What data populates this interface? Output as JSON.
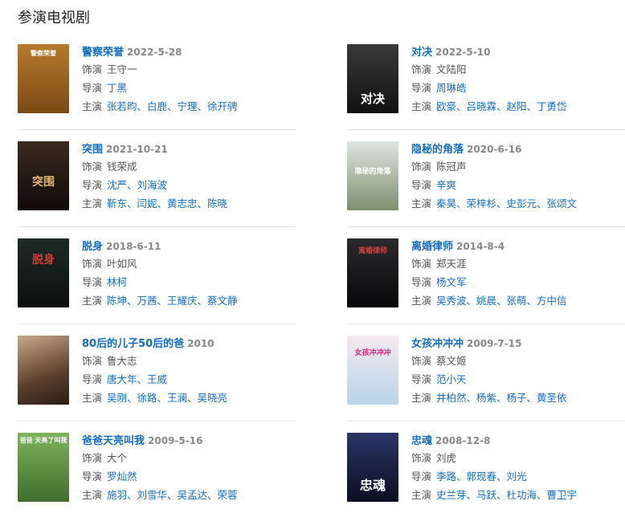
{
  "section_title": "参演电视剧",
  "labels": {
    "role": "饰演",
    "director": "导演",
    "cast": "主演"
  },
  "shows": [
    {
      "title": "警察荣誉",
      "date": "2022-5-28",
      "role": "王守一",
      "director": "丁黑",
      "cast": "张若昀、白鹿、宁理、徐开骋",
      "poster": "警察荣誉"
    },
    {
      "title": "对决",
      "date": "2022-5-10",
      "role": "文陆阳",
      "director": "周琳皓",
      "cast": "欧豪、吕晓霖、赵阳、丁勇岱",
      "poster": "对决"
    },
    {
      "title": "突围",
      "date": "2021-10-21",
      "role": "钱荣成",
      "director": "沈严、刘海波",
      "cast": "靳东、闫妮、黄志忠、陈晓",
      "poster": "突围"
    },
    {
      "title": "隐秘的角落",
      "date": "2020-6-16",
      "role": "陈冠声",
      "director": "辛爽",
      "cast": "秦昊、荣梓杉、史彭元、张颂文",
      "poster": "隐秘的角落"
    },
    {
      "title": "脱身",
      "date": "2018-6-11",
      "role": "叶如风",
      "director": "林柯",
      "cast": "陈坤、万茜、王耀庆、蔡文静",
      "poster": "脱身"
    },
    {
      "title": "离婚律师",
      "date": "2014-8-4",
      "role": "郑天涯",
      "director": "杨文军",
      "cast": "吴秀波、姚晨、张萌、方中信",
      "poster": "离婚律师"
    },
    {
      "title": "80后的儿子50后的爸",
      "date": "2010",
      "role": "鲁大志",
      "director": "唐大年、王威",
      "cast": "吴刚、徐路、王澜、吴晓亮",
      "poster": ""
    },
    {
      "title": "女孩冲冲冲",
      "date": "2009-7-15",
      "role": "蔡文姬",
      "director": "范小天",
      "cast": "井柏然、杨紫、杨子、黄圣依",
      "poster": "女孩冲冲冲"
    },
    {
      "title": "爸爸天亮叫我",
      "date": "2009-5-16",
      "role": "大个",
      "director": "罗灿然",
      "cast": "施羽、刘雪华、吴孟达、荣蓉",
      "poster": "爸爸 天亮了叫我"
    },
    {
      "title": "忠魂",
      "date": "2008-12-8",
      "role": "刘虎",
      "director": "李路、郭现春、刘光",
      "cast": "史兰芽、马跃、杜功海、曹卫宇",
      "poster": "忠魂"
    }
  ],
  "colors": {
    "link": "#136ec2",
    "text": "#555555",
    "date": "#888888"
  }
}
